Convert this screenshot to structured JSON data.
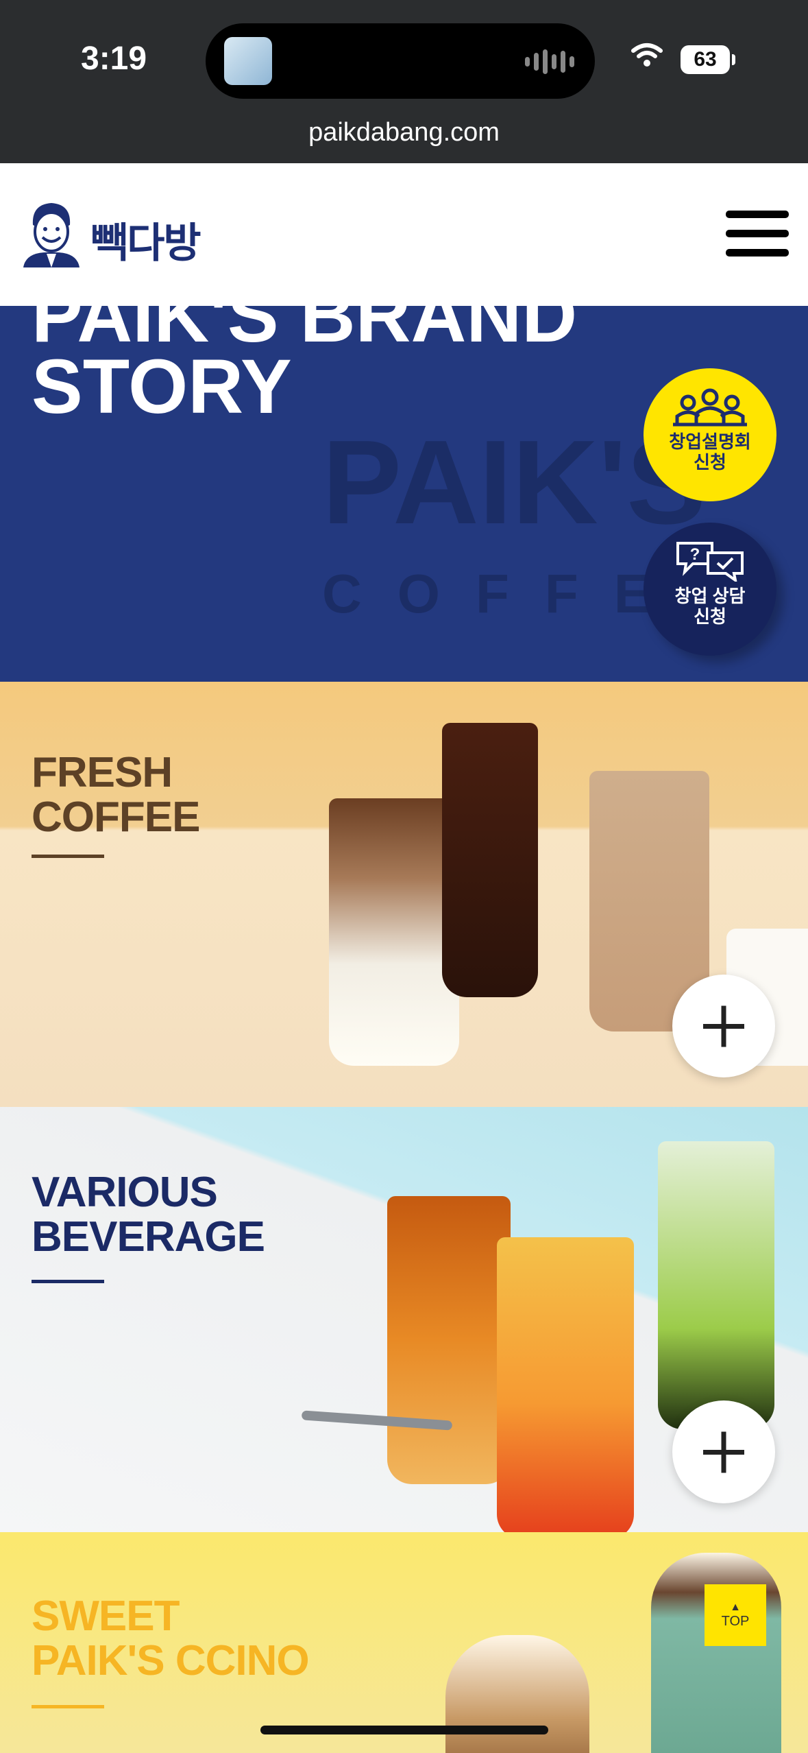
{
  "status_bar": {
    "time": "3:19",
    "battery": "63",
    "url": "paikdabang.com"
  },
  "header": {
    "logo_text": "빽다방",
    "menu_icon": "hamburger-menu-icon"
  },
  "hero": {
    "title": "PAIK'S BRAND\nSTORY",
    "watermark_main": "PAIK'S",
    "watermark_sub": "COFFEE",
    "background_color": "#23397f"
  },
  "floating_buttons": {
    "seminar_label": "창업설명회\n신청",
    "consult_label": "창업 상담\n신청",
    "seminar_color": "#ffe500",
    "consult_color": "#16235c"
  },
  "sections": [
    {
      "title": "FRESH\nCOFFEE",
      "title_color": "#5d4126",
      "icon": "plus-icon"
    },
    {
      "title": "VARIOUS\nBEVERAGE",
      "title_color": "#1b2a66",
      "icon": "plus-icon"
    },
    {
      "title": "SWEET\nPAIK'S CCINO",
      "title_color": "#f6b524"
    }
  ],
  "top_button": {
    "arrow": "▲",
    "label": "TOP"
  }
}
